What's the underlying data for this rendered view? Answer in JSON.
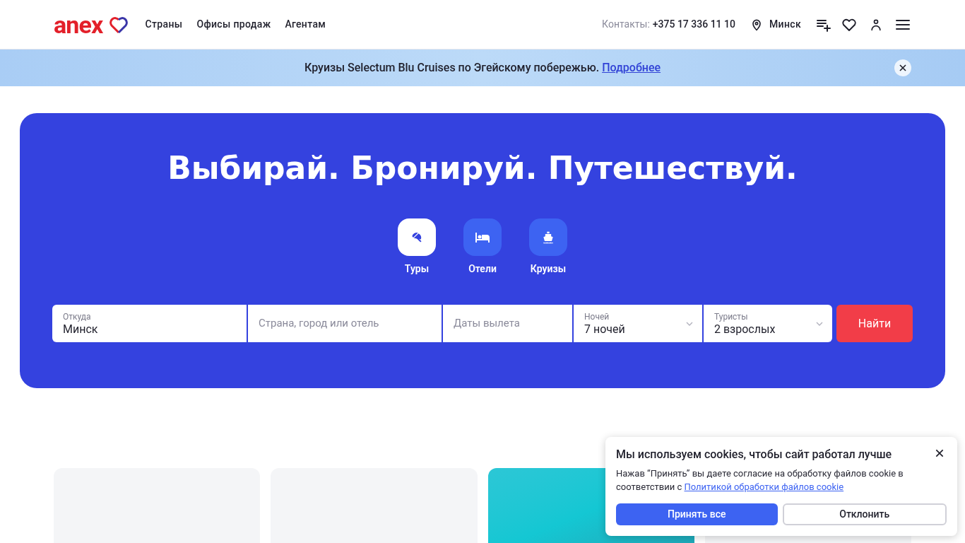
{
  "header": {
    "logo": "anex",
    "nav": [
      "Страны",
      "Офисы продаж",
      "Агентам"
    ],
    "contacts_label": "Контакты:",
    "phone": "+375 17 336 11 10",
    "city": "Минск"
  },
  "banner": {
    "text": "Круизы Selectum Blu Cruises по Эгейскому побережью.",
    "link": "Подробнее"
  },
  "hero": {
    "title": "Выбирай. Бронируй. Путешествуй.",
    "tabs": [
      {
        "label": "Туры",
        "kind": "tours",
        "selected": true
      },
      {
        "label": "Отели",
        "kind": "hotels",
        "selected": false
      },
      {
        "label": "Круизы",
        "kind": "cruises",
        "selected": false
      }
    ],
    "fields": [
      {
        "label": "Откуда",
        "value": "Минск",
        "dropdown": false
      },
      {
        "placeholder": "Страна, город или отель",
        "dropdown": false
      },
      {
        "placeholder": "Даты вылета",
        "dropdown": false
      },
      {
        "label": "Ночей",
        "value": "7 ночей",
        "dropdown": true
      },
      {
        "label": "Туристы",
        "value": "2 взрослых",
        "dropdown": true
      }
    ],
    "search_button": "Найти"
  },
  "cards": [
    {
      "kind": "blank"
    },
    {
      "kind": "blank"
    },
    {
      "kind": "gradient"
    },
    {
      "kind": "blank"
    }
  ],
  "cookie": {
    "title": "Мы используем cookies, чтобы сайт работал лучше",
    "text": "Нажав “Принять” вы даете согласие на обработку файлов cookie в соответствии с",
    "link": "Политикой обработки файлов cookie",
    "accept": "Принять все",
    "decline": "Отклонить"
  }
}
